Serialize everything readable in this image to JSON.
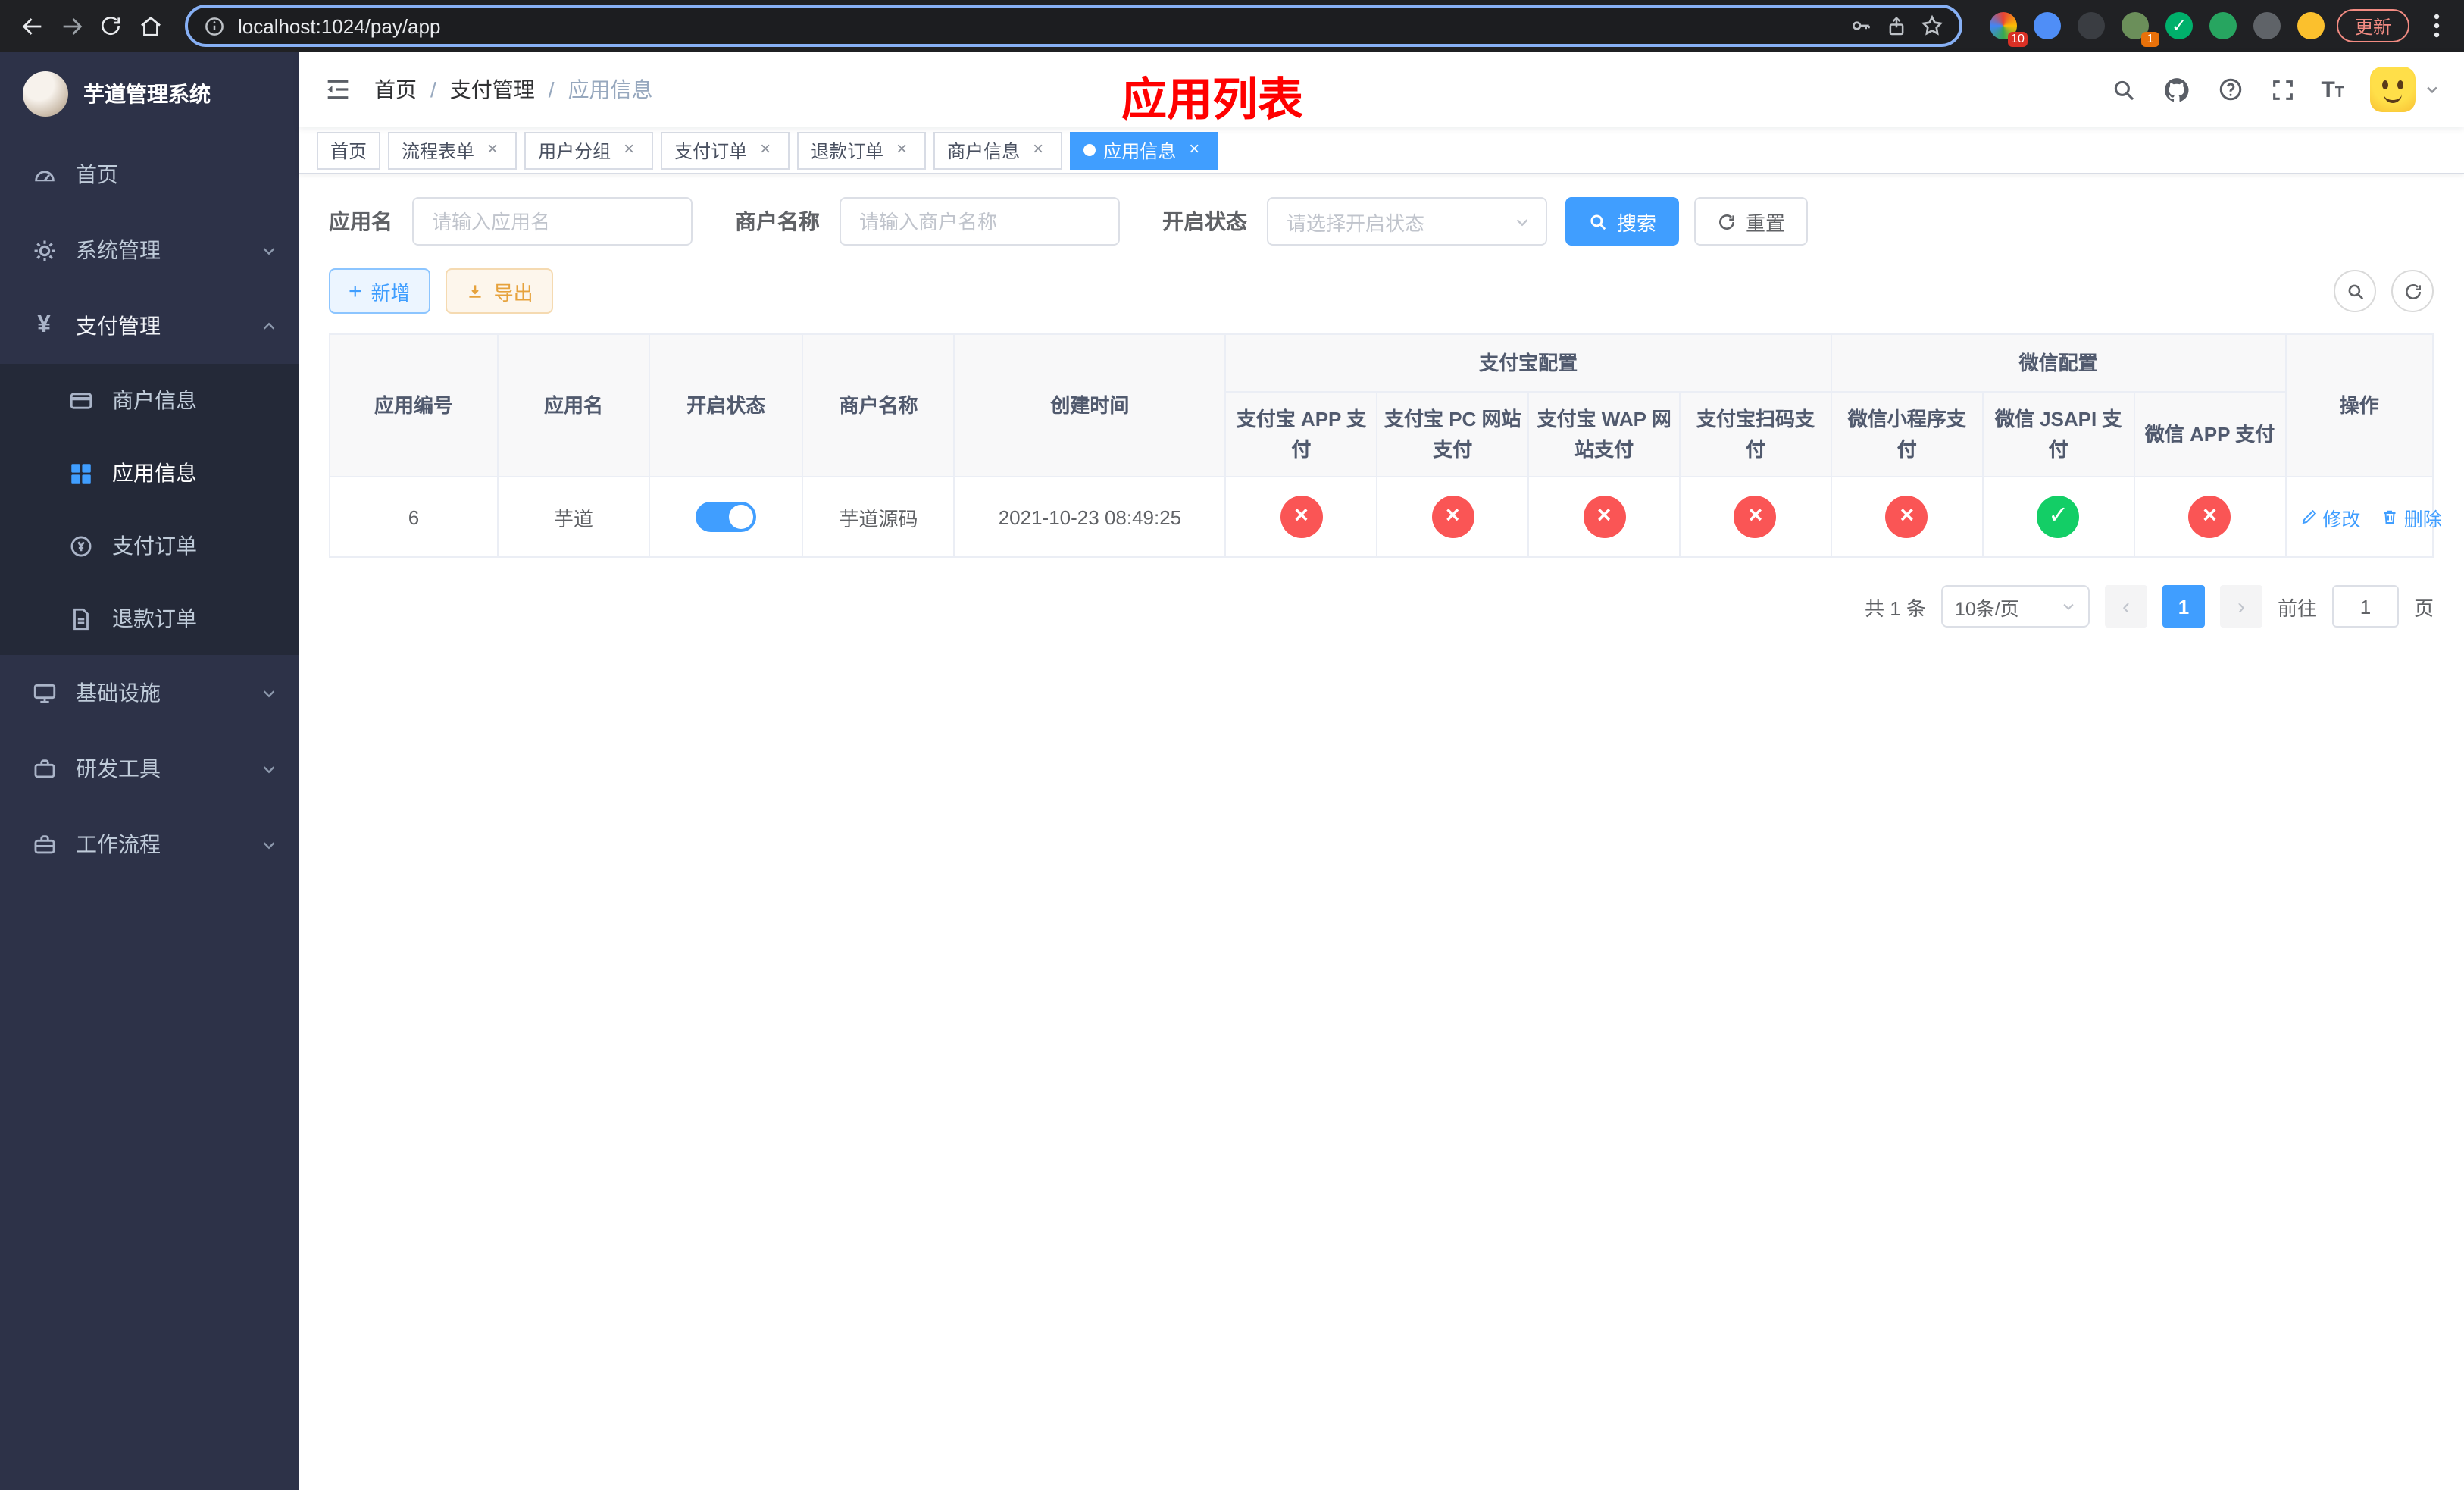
{
  "ui": {
    "close_glyph": "×",
    "plus_glyph": "+",
    "breadcrumb_sep": "/",
    "font_icon": "T",
    "yen_glyph": "¥"
  },
  "browser": {
    "url": "localhost:1024/pay/app",
    "update_label": "更新",
    "ext_badge_1": "10",
    "ext_badge_2": "1"
  },
  "sidebar": {
    "logo_title": "芋道管理系统",
    "items": [
      {
        "label": "首页"
      },
      {
        "label": "系统管理"
      },
      {
        "label": "支付管理"
      },
      {
        "label": "基础设施"
      },
      {
        "label": "研发工具"
      },
      {
        "label": "工作流程"
      }
    ],
    "pay_submenu": [
      {
        "label": "商户信息"
      },
      {
        "label": "应用信息"
      },
      {
        "label": "支付订单"
      },
      {
        "label": "退款订单"
      }
    ]
  },
  "header": {
    "breadcrumb": [
      "首页",
      "支付管理",
      "应用信息"
    ],
    "overlay_title": "应用列表"
  },
  "tabs": [
    {
      "label": "首页"
    },
    {
      "label": "流程表单"
    },
    {
      "label": "用户分组"
    },
    {
      "label": "支付订单"
    },
    {
      "label": "退款订单"
    },
    {
      "label": "商户信息"
    },
    {
      "label": "应用信息"
    }
  ],
  "filters": {
    "app_name_label": "应用名",
    "app_name_placeholder": "请输入应用名",
    "merchant_label": "商户名称",
    "merchant_placeholder": "请输入商户名称",
    "status_label": "开启状态",
    "status_placeholder": "请选择开启状态",
    "search_label": "搜索",
    "reset_label": "重置"
  },
  "toolbar": {
    "add_label": "新增",
    "export_label": "导出"
  },
  "table": {
    "col_id": "应用编号",
    "col_name": "应用名",
    "col_status": "开启状态",
    "col_merchant": "商户名称",
    "col_created": "创建时间",
    "group_alipay": "支付宝配置",
    "group_wechat": "微信配置",
    "col_op": "操作",
    "alipay_cols": [
      "支付宝 APP 支付",
      "支付宝 PC 网站支付",
      "支付宝 WAP 网站支付",
      "支付宝扫码支付"
    ],
    "wechat_cols": [
      "微信小程序支付",
      "微信 JSAPI 支付",
      "微信 APP 支付"
    ],
    "row": {
      "id": "6",
      "name": "芋道",
      "merchant": "芋道源码",
      "created": "2021-10-23 08:49:25",
      "toggle_class": "switch on",
      "channels": [
        {
          "name": "alipay-app-status",
          "cls": "status-circle cross",
          "glyph": "×"
        },
        {
          "name": "alipay-pc-status",
          "cls": "status-circle cross",
          "glyph": "×"
        },
        {
          "name": "alipay-wap-status",
          "cls": "status-circle cross",
          "glyph": "×"
        },
        {
          "name": "alipay-scan-status",
          "cls": "status-circle cross",
          "glyph": "×"
        },
        {
          "name": "wechat-mini-status",
          "cls": "status-circle cross",
          "glyph": "×"
        },
        {
          "name": "wechat-jsapi-status",
          "cls": "status-circle check",
          "glyph": "✓"
        },
        {
          "name": "wechat-app-status",
          "cls": "status-circle cross",
          "glyph": "×"
        }
      ],
      "edit_label": "修改",
      "delete_label": "删除"
    }
  },
  "pagination": {
    "total": "共 1 条",
    "page_size": "10条/页",
    "prev_glyph": "‹",
    "page": "1",
    "next_glyph": "›",
    "jump_prefix": "前往",
    "jump_value": "1",
    "jump_suffix": "页"
  }
}
